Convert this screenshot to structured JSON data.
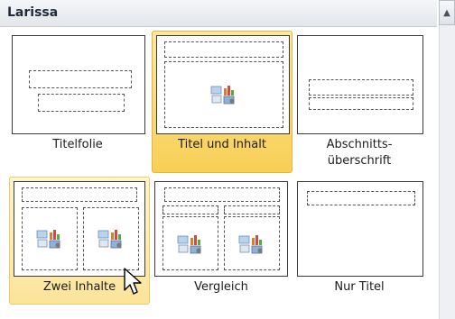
{
  "section": {
    "title": "Larissa"
  },
  "layouts": [
    {
      "label": "Titelfolie"
    },
    {
      "label": "Titel und Inhalt"
    },
    {
      "label_line1": "Abschnitts-",
      "label_line2": "überschrift"
    },
    {
      "label": "Zwei Inhalte"
    },
    {
      "label": "Vergleich"
    },
    {
      "label": "Nur Titel"
    }
  ],
  "colors": {
    "selected": "#f8cf55",
    "hover": "#fbe49a",
    "header": "#e3e6ea"
  }
}
